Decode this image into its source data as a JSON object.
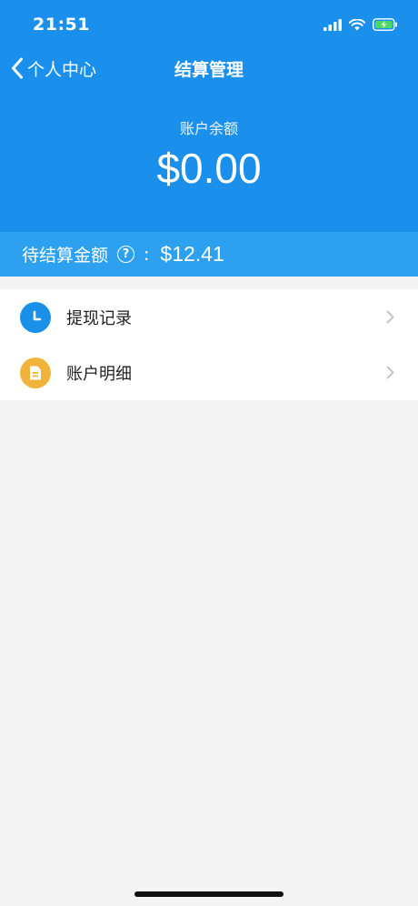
{
  "status_bar": {
    "time": "21:51"
  },
  "nav": {
    "back_label": "个人中心",
    "title": "结算管理"
  },
  "balance": {
    "label": "账户余额",
    "value": "$0.00"
  },
  "pending": {
    "label": "待结算金额",
    "help_symbol": "?",
    "separator": ":",
    "value": "$12.41"
  },
  "menu": {
    "items": [
      {
        "label": "提现记录",
        "icon": "clock-icon",
        "icon_color": "#1a90e8"
      },
      {
        "label": "账户明细",
        "icon": "document-icon",
        "icon_color": "#f2b33a"
      }
    ]
  },
  "colors": {
    "header_bg": "#1a90ec",
    "pending_bg": "#2ea0f0",
    "page_bg": "#f4f4f5"
  }
}
